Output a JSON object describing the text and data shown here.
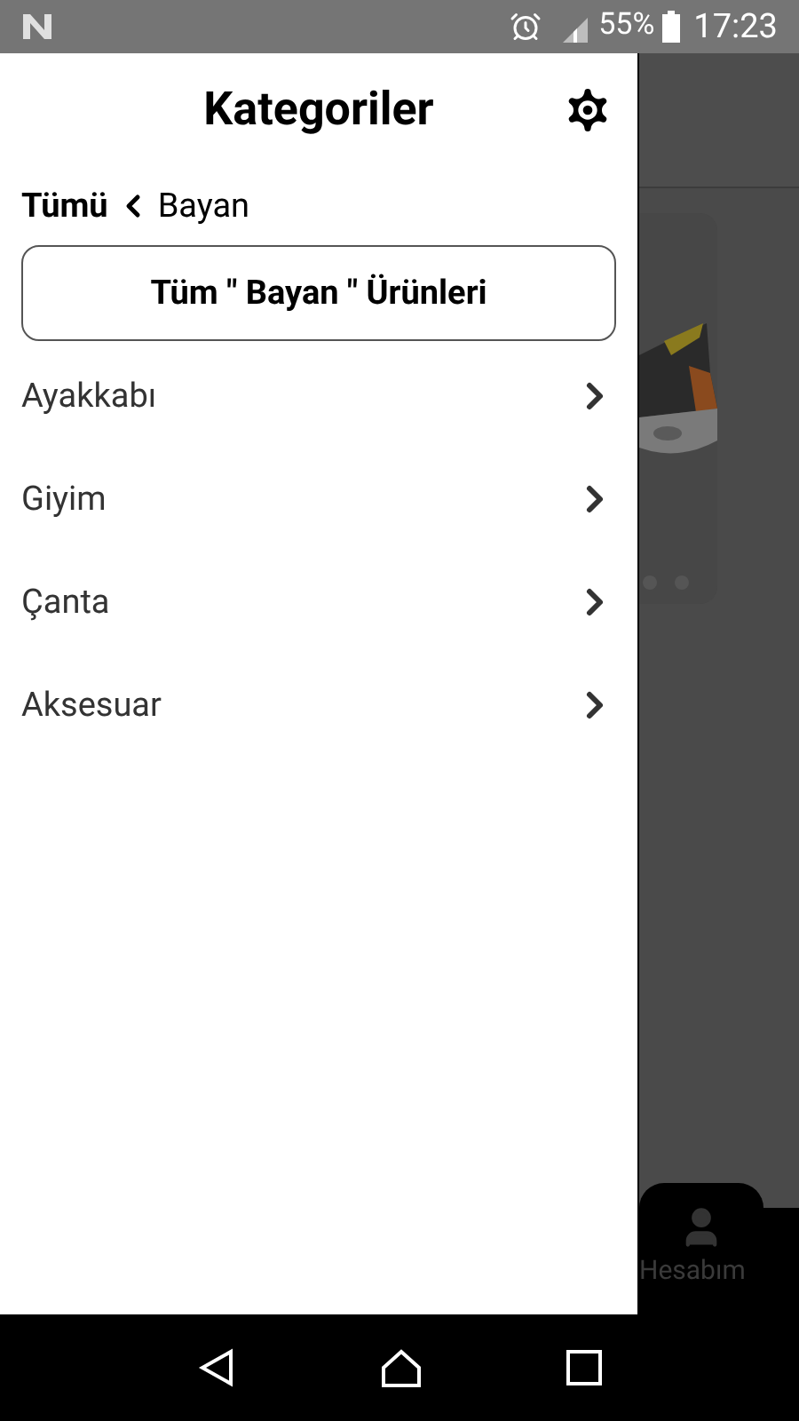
{
  "status_bar": {
    "battery": "55%",
    "time": "17:23"
  },
  "drawer": {
    "title": "Kategoriler",
    "breadcrumb": {
      "root": "Tümü",
      "current": "Bayan"
    },
    "all_button": "Tüm \" Bayan \" Ürünleri",
    "categories": [
      {
        "label": "Ayakkabı"
      },
      {
        "label": "Giyim"
      },
      {
        "label": "Çanta"
      },
      {
        "label": "Aksesuar"
      }
    ]
  },
  "background": {
    "bottom_nav_label": "Hesabım"
  }
}
